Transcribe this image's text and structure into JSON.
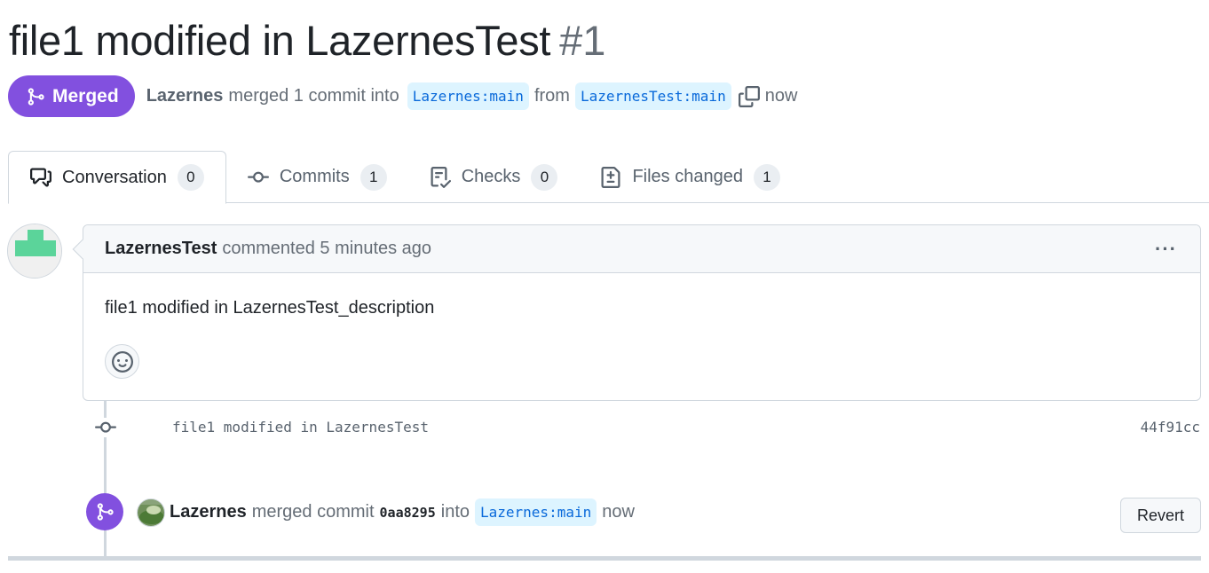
{
  "pr": {
    "title": "file1 modified in LazernesTest",
    "number": "#1",
    "state": "Merged",
    "merge_author": "Lazernes",
    "merge_summary": "merged 1 commit into",
    "base_branch": "Lazernes:main",
    "from_word": "from",
    "head_branch": "LazernesTest:main",
    "merged_time": "now"
  },
  "tabs": [
    {
      "label": "Conversation",
      "count": "0"
    },
    {
      "label": "Commits",
      "count": "1"
    },
    {
      "label": "Checks",
      "count": "0"
    },
    {
      "label": "Files changed",
      "count": "1"
    }
  ],
  "comment": {
    "author": "LazernesTest",
    "action": "commented 5 minutes ago",
    "body": "file1 modified in LazernesTest_description",
    "menu": "···"
  },
  "commit": {
    "message": "file1 modified in LazernesTest",
    "sha": "44f91cc"
  },
  "merge_event": {
    "author": "Lazernes",
    "action": "merged commit",
    "sha": "0aa8295",
    "into_word": "into",
    "branch": "Lazernes:main",
    "time": "now",
    "revert_label": "Revert"
  },
  "colors": {
    "merged_purple": "#8250df",
    "branch_bg": "#ddf4ff",
    "branch_fg": "#0969da",
    "border": "#d0d7de"
  },
  "icons": [
    "git-merge-icon",
    "copy-icon",
    "comment-discussion-icon",
    "git-commit-icon",
    "checklist-icon",
    "file-diff-icon",
    "smiley-icon",
    "kebab-horizontal-icon"
  ]
}
